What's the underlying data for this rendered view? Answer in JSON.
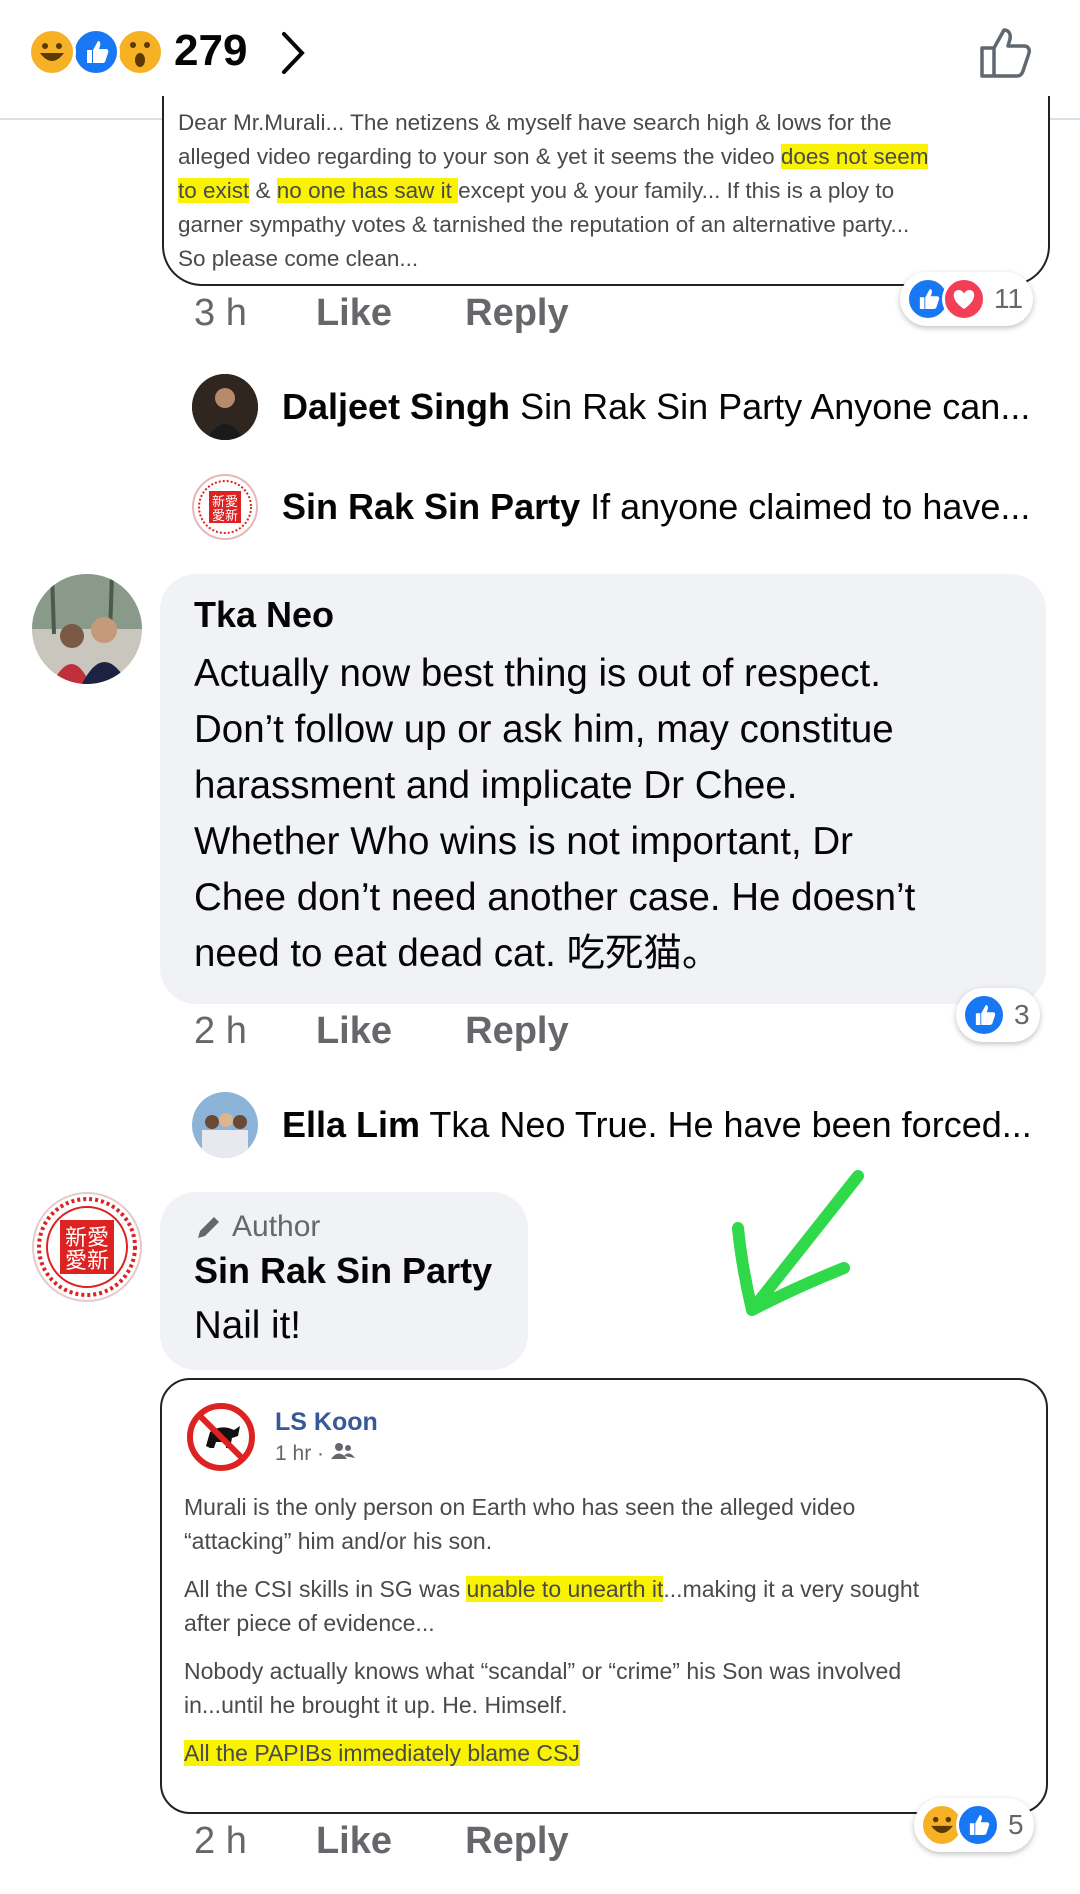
{
  "header": {
    "reaction_count": "279",
    "reaction_icons": [
      "haha-icon",
      "like-icon",
      "wow-icon"
    ]
  },
  "comment1": {
    "lines": [
      [
        "Dear Mr.Murali... The netizens & myself have search high & lows for the"
      ],
      [
        "alleged video regarding to your son & yet it seems the video ",
        {
          "hl": "does not seem"
        }
      ],
      [
        {
          "hl": "to exist"
        },
        " & ",
        {
          "hl": "no one has saw it "
        },
        "except you & your family... If this is a ploy to"
      ],
      [
        "garner sympathy votes & tarnished the reputation of an alternative party..."
      ],
      [
        "So please come clean..."
      ]
    ],
    "time": "3 h",
    "like_label": "Like",
    "reply_label": "Reply",
    "reaction_count": "11"
  },
  "replies1": [
    {
      "name": "Daljeet Singh",
      "text": "Sin Rak Sin Party Anyone can..."
    },
    {
      "name": "Sin Rak Sin Party",
      "text": "If anyone claimed to have..."
    }
  ],
  "comment2": {
    "author": "Tka Neo",
    "lines": [
      "Actually now best thing is out of respect.",
      "Don’t follow up or ask him, may constitue",
      "harassment and implicate Dr Chee.",
      "Whether Who wins is not important, Dr",
      "Chee don’t need another case. He doesn’t",
      "need to eat dead cat. 吃死猫。"
    ],
    "time": "2 h",
    "like_label": "Like",
    "reply_label": "Reply",
    "reaction_count": "3"
  },
  "replies2": [
    {
      "name": "Ella Lim",
      "text": "Tka Neo True. He have been forced..."
    }
  ],
  "comment3": {
    "badge": "Author",
    "author": "Sin Rak Sin Party",
    "text": "Nail it!",
    "logo_text": "新愛愛新",
    "embedded": {
      "name": "LS Koon",
      "time": "1 hr ·",
      "paragraphs": [
        [
          [
            "Murali is the only person on Earth who has seen the alleged video"
          ],
          [
            "“attacking” him and/or his son."
          ]
        ],
        [
          [
            "All the CSI skills in SG was ",
            {
              "hl": "unable to unearth it"
            },
            "...making it a very sought"
          ],
          [
            "after piece of evidence..."
          ]
        ],
        [
          [
            "Nobody actually knows what “scandal” or “crime” his Son was involved"
          ],
          [
            "in...until he brought it up. He. Himself."
          ]
        ],
        [
          [
            {
              "hl": "All the PAPIBs immediately blame CSJ"
            }
          ]
        ]
      ]
    },
    "time": "2 h",
    "like_label": "Like",
    "reply_label": "Reply",
    "reaction_count": "5"
  },
  "colors": {
    "like_blue": "#1877f2",
    "love_red": "#f33e58",
    "haha_yellow": "#f7b125",
    "highlight": "#f9f200",
    "arrow_green": "#2fd94a",
    "author_name_blue": "#385898"
  }
}
